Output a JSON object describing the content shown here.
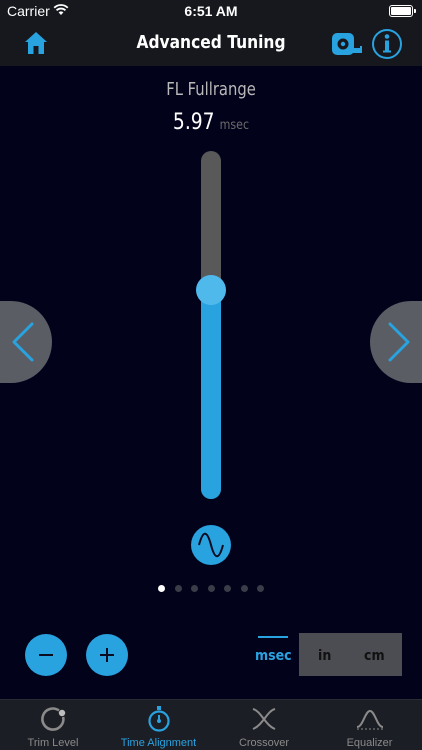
{
  "status_bar": {
    "carrier": "Carrier",
    "time": "6:51 AM"
  },
  "nav": {
    "title": "Advanced Tuning",
    "left_icon": "home-icon",
    "right_icons": [
      "tape-measure-icon",
      "info-icon"
    ]
  },
  "channel": {
    "name": "FL Fullrange",
    "value": "5.97",
    "unit": "msec"
  },
  "slider": {
    "level_fraction": 0.6
  },
  "pager": {
    "count": 7,
    "active_index": 0
  },
  "units": {
    "options": [
      "msec",
      "in",
      "cm"
    ],
    "selected": "msec"
  },
  "tabs": [
    {
      "label": "Trim Level",
      "icon": "trim-level-icon",
      "active": false
    },
    {
      "label": "Time Alignment",
      "icon": "stopwatch-icon",
      "active": true
    },
    {
      "label": "Crossover",
      "icon": "crossover-icon",
      "active": false
    },
    {
      "label": "Equalizer",
      "icon": "equalizer-icon",
      "active": false
    }
  ],
  "colors": {
    "accent": "#29a2e0",
    "background": "#02031b",
    "bar": "#16181e",
    "track": "#595959"
  }
}
